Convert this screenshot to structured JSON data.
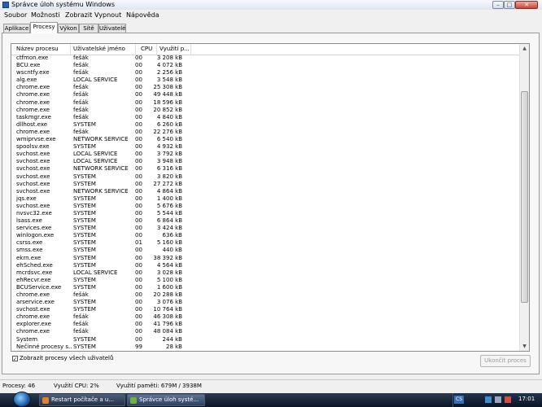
{
  "window": {
    "title": "Správce úloh systému Windows"
  },
  "menu": [
    "Soubor",
    "Možnosti",
    "Zobrazit",
    "Vypnout",
    "Nápověda"
  ],
  "tabs": [
    {
      "label": "Aplikace",
      "active": false
    },
    {
      "label": "Procesy",
      "active": true
    },
    {
      "label": "Výkon",
      "active": false
    },
    {
      "label": "Sítě",
      "active": false
    },
    {
      "label": "Uživatelé",
      "active": false
    }
  ],
  "columns": [
    "Název procesu",
    "Uživatelské jméno",
    "CPU",
    "Využití p..."
  ],
  "processes": [
    [
      "ctfmon.exe",
      "fešák",
      "00",
      "3 208 kB"
    ],
    [
      "BCU.exe",
      "fešák",
      "00",
      "4 072 kB"
    ],
    [
      "wscntfy.exe",
      "fešák",
      "00",
      "2 256 kB"
    ],
    [
      "alg.exe",
      "LOCAL SERVICE",
      "00",
      "3 548 kB"
    ],
    [
      "chrome.exe",
      "fešák",
      "00",
      "25 308 kB"
    ],
    [
      "chrome.exe",
      "fešák",
      "00",
      "49 448 kB"
    ],
    [
      "chrome.exe",
      "fešák",
      "00",
      "18 596 kB"
    ],
    [
      "chrome.exe",
      "fešák",
      "00",
      "20 852 kB"
    ],
    [
      "taskmgr.exe",
      "fešák",
      "00",
      "4 840 kB"
    ],
    [
      "dllhost.exe",
      "SYSTEM",
      "00",
      "6 260 kB"
    ],
    [
      "chrome.exe",
      "fešák",
      "00",
      "22 276 kB"
    ],
    [
      "wmiprvse.exe",
      "NETWORK SERVICE",
      "00",
      "6 540 kB"
    ],
    [
      "spoolsv.exe",
      "SYSTEM",
      "00",
      "4 932 kB"
    ],
    [
      "svchost.exe",
      "LOCAL SERVICE",
      "00",
      "3 792 kB"
    ],
    [
      "svchost.exe",
      "LOCAL SERVICE",
      "00",
      "3 948 kB"
    ],
    [
      "svchost.exe",
      "NETWORK SERVICE",
      "00",
      "6 316 kB"
    ],
    [
      "svchost.exe",
      "SYSTEM",
      "00",
      "3 820 kB"
    ],
    [
      "svchost.exe",
      "SYSTEM",
      "00",
      "27 272 kB"
    ],
    [
      "svchost.exe",
      "NETWORK SERVICE",
      "00",
      "4 864 kB"
    ],
    [
      "jqs.exe",
      "SYSTEM",
      "00",
      "1 400 kB"
    ],
    [
      "svchost.exe",
      "SYSTEM",
      "00",
      "5 676 kB"
    ],
    [
      "nvsvc32.exe",
      "SYSTEM",
      "00",
      "5 544 kB"
    ],
    [
      "lsass.exe",
      "SYSTEM",
      "00",
      "6 864 kB"
    ],
    [
      "services.exe",
      "SYSTEM",
      "00",
      "3 424 kB"
    ],
    [
      "winlogon.exe",
      "SYSTEM",
      "00",
      "636 kB"
    ],
    [
      "csrss.exe",
      "SYSTEM",
      "01",
      "5 160 kB"
    ],
    [
      "smss.exe",
      "SYSTEM",
      "00",
      "440 kB"
    ],
    [
      "ekrn.exe",
      "SYSTEM",
      "00",
      "38 392 kB"
    ],
    [
      "ehSched.exe",
      "SYSTEM",
      "00",
      "4 564 kB"
    ],
    [
      "mcrdsvc.exe",
      "LOCAL SERVICE",
      "00",
      "3 028 kB"
    ],
    [
      "ehRecvr.exe",
      "SYSTEM",
      "00",
      "5 100 kB"
    ],
    [
      "BCUService.exe",
      "SYSTEM",
      "00",
      "1 600 kB"
    ],
    [
      "chrome.exe",
      "fešák",
      "00",
      "20 288 kB"
    ],
    [
      "arservice.exe",
      "SYSTEM",
      "00",
      "3 076 kB"
    ],
    [
      "svchost.exe",
      "SYSTEM",
      "00",
      "10 764 kB"
    ],
    [
      "chrome.exe",
      "fešák",
      "00",
      "46 308 kB"
    ],
    [
      "explorer.exe",
      "fešák",
      "00",
      "41 796 kB"
    ],
    [
      "chrome.exe",
      "fešák",
      "00",
      "48 084 kB"
    ],
    [
      "System",
      "SYSTEM",
      "00",
      "244 kB"
    ],
    [
      "Nečinné procesy s...",
      "SYSTEM",
      "99",
      "28 kB"
    ]
  ],
  "show_all_users": {
    "label": "Zobrazit procesy všech uživatelů",
    "checked": true
  },
  "end_process_button": "Ukončit proces",
  "status": {
    "processes": "Procesy: 46",
    "cpu": "Využití CPU: 2%",
    "memory": "Využití paměti: 679M / 3938M"
  },
  "taskbar": {
    "buttons": [
      "Restart počítače a u...",
      "Správce úloh systé..."
    ],
    "language": "CS",
    "clock": "17:01"
  },
  "colors": {
    "accent": "#2a5fb0",
    "taskbar": "#1b2638"
  }
}
